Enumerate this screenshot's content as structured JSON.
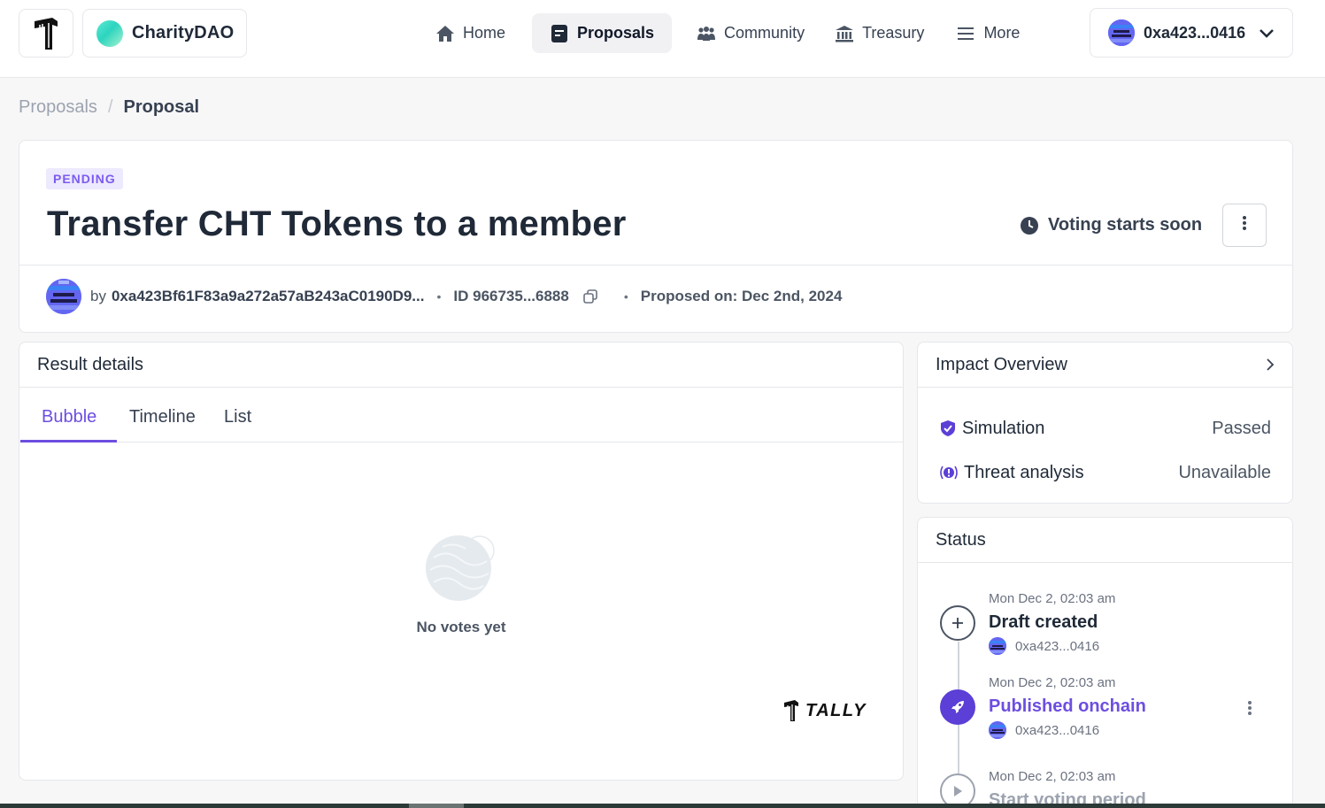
{
  "topbar": {
    "dao_name": "CharityDAO",
    "nav": [
      {
        "label": "Home",
        "icon": "home-icon"
      },
      {
        "label": "Proposals",
        "icon": "proposals-icon",
        "active": true
      },
      {
        "label": "Community",
        "icon": "community-icon"
      },
      {
        "label": "Treasury",
        "icon": "treasury-icon"
      },
      {
        "label": "More",
        "icon": "menu-icon"
      }
    ],
    "wallet": "0xa423...0416"
  },
  "breadcrumb": {
    "parent": "Proposals",
    "separator": "/",
    "current": "Proposal"
  },
  "proposal": {
    "status_badge": "PENDING",
    "title": "Transfer CHT Tokens to a member",
    "voting_status": "Voting starts soon",
    "by_label": "by",
    "author": "0xa423Bf61F83a9a272a57aB243aC0190D9...",
    "id": "ID 966735...6888",
    "proposed_on": "Proposed on: Dec 2nd, 2024"
  },
  "results": {
    "title": "Result details",
    "tabs": [
      "Bubble",
      "Timeline",
      "List"
    ],
    "active_tab": "Bubble",
    "empty_text": "No votes yet",
    "brand": "TALLY"
  },
  "impact": {
    "title": "Impact Overview",
    "rows": [
      {
        "label": "Simulation",
        "value": "Passed",
        "icon": "shield-check-icon"
      },
      {
        "label": "Threat analysis",
        "value": "Unavailable",
        "icon": "alert-icon"
      }
    ]
  },
  "status": {
    "title": "Status",
    "events": [
      {
        "date": "Mon Dec 2, 02:03 am",
        "title": "Draft created",
        "by": "0xa423...0416",
        "icon": "plus-icon"
      },
      {
        "date": "Mon Dec 2, 02:03 am",
        "title": "Published onchain",
        "by": "0xa423...0416",
        "icon": "rocket-icon"
      },
      {
        "date": "Mon Dec 2, 02:03 am",
        "title": "Start voting period",
        "icon": "play-icon"
      }
    ]
  },
  "colors": {
    "accent": "#6d4ee0",
    "badge_bg": "#ede9fe",
    "border": "#e5e7eb"
  }
}
